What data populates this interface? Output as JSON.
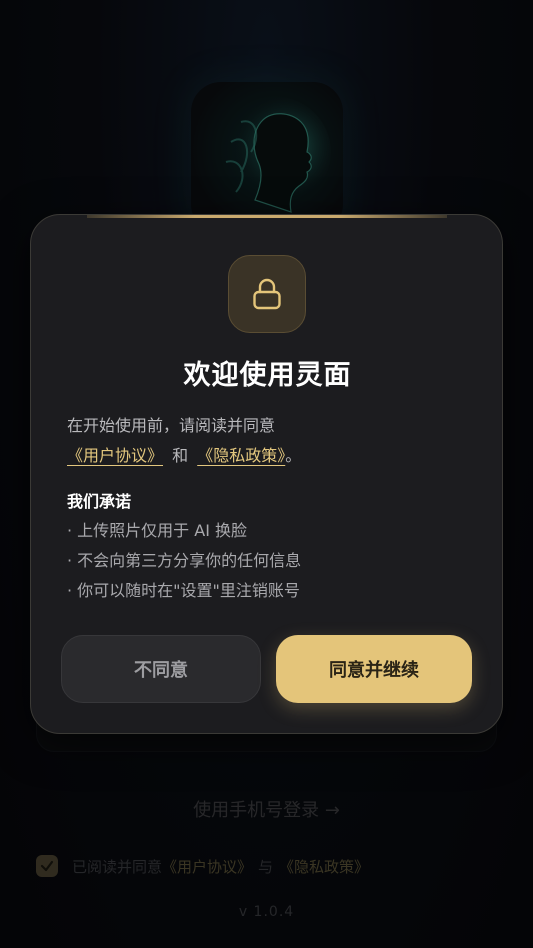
{
  "background": {
    "phone_login_label": "使用手机号登录 →",
    "agree_prefix": "已阅读并同意",
    "agree_link_user": "《用户协议》",
    "agree_mid": "与",
    "agree_link_privacy": "《隐私政策》",
    "agree_checked": true,
    "version": "v 1.0.4"
  },
  "modal": {
    "title": "欢迎使用灵面",
    "intro_line1": "在开始使用前，请阅读并同意",
    "user_agreement_link": "《用户协议》",
    "and_text": "和",
    "privacy_policy_link": "《隐私政策》",
    "period": "。",
    "promise_title": "我们承诺",
    "promises": [
      "· 上传照片仅用于 AI 换脸",
      "· 不会向第三方分享你的任何信息",
      "· 你可以随时在\"设置\"里注销账号"
    ],
    "disagree_label": "不同意",
    "agree_label": "同意并继续"
  },
  "colors": {
    "accent": "#e4c57a",
    "modal_bg": "#1c1c1f",
    "link": "#e3c77e"
  },
  "icons": {
    "lock": "lock-icon",
    "check": "check-icon",
    "logo": "face-logo-icon"
  }
}
